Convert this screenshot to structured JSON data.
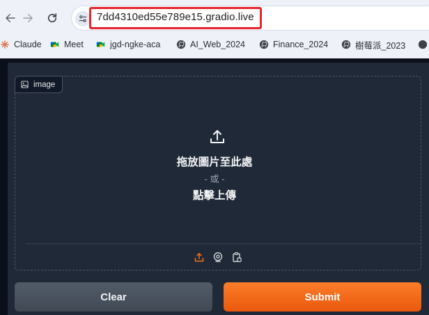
{
  "browser": {
    "url": "7dd4310ed55e789e15.gradio.live",
    "bookmarks": [
      {
        "label": "Claude",
        "icon": "claude-icon"
      },
      {
        "label": "Meet",
        "icon": "meet-icon"
      },
      {
        "label": "jgd-ngke-aca",
        "icon": "meet-icon"
      },
      {
        "label": "AI_Web_2024",
        "icon": "github-icon"
      },
      {
        "label": "Finance_2024",
        "icon": "github-icon"
      },
      {
        "label": "樹莓派_2023",
        "icon": "github-icon"
      }
    ]
  },
  "image_input": {
    "label": "image",
    "drop_text": "拖放圖片至此處",
    "or_text": "- 或 -",
    "click_text": "點擊上傳"
  },
  "buttons": {
    "clear": "Clear",
    "submit": "Submit"
  },
  "colors": {
    "accent": "#f97316",
    "highlight_border": "#e8232c",
    "panel_bg": "#1f2937"
  }
}
